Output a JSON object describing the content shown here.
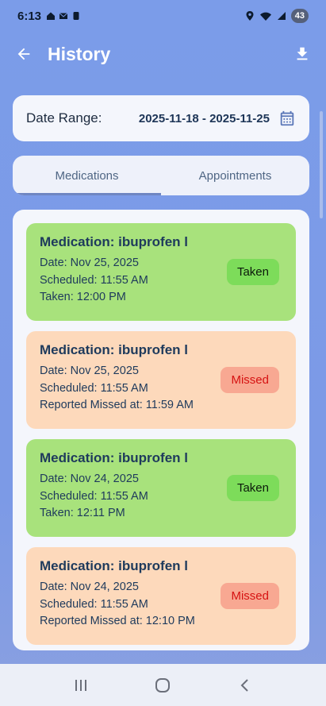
{
  "status_bar": {
    "time": "6:13",
    "battery": "43"
  },
  "app_bar": {
    "title": "History"
  },
  "date_range": {
    "label": "Date Range:",
    "value": "2025-11-18 - 2025-11-25"
  },
  "tabs": [
    {
      "label": "Medications",
      "active": true
    },
    {
      "label": "Appointments",
      "active": false
    }
  ],
  "entries": [
    {
      "status": "taken",
      "title": "Medication: ibuprofen l",
      "date": "Date: Nov 25, 2025",
      "scheduled": "Scheduled: 11:55 AM",
      "detail": "Taken: 12:00 PM",
      "badge": "Taken"
    },
    {
      "status": "missed",
      "title": "Medication: ibuprofen l",
      "date": "Date: Nov 25, 2025",
      "scheduled": "Scheduled: 11:55 AM",
      "detail": "Reported Missed at: 11:59 AM",
      "badge": "Missed"
    },
    {
      "status": "taken",
      "title": "Medication: ibuprofen l",
      "date": "Date: Nov 24, 2025",
      "scheduled": "Scheduled: 11:55 AM",
      "detail": "Taken: 12:11 PM",
      "badge": "Taken"
    },
    {
      "status": "missed",
      "title": "Medication: ibuprofen l",
      "date": "Date: Nov 24, 2025",
      "scheduled": "Scheduled: 11:55 AM",
      "detail": "Reported Missed at: 12:10 PM",
      "badge": "Missed"
    }
  ],
  "icons": {
    "back": "arrow-left-icon",
    "download": "download-icon",
    "calendar": "calendar-icon"
  },
  "colors": {
    "taken_bg": "#a8e27c",
    "missed_bg": "#fdd9bb",
    "taken_badge": "#7ddc5a",
    "missed_badge": "#f8a892",
    "missed_text": "#d61212",
    "header_bg": "#7b9ce9"
  }
}
